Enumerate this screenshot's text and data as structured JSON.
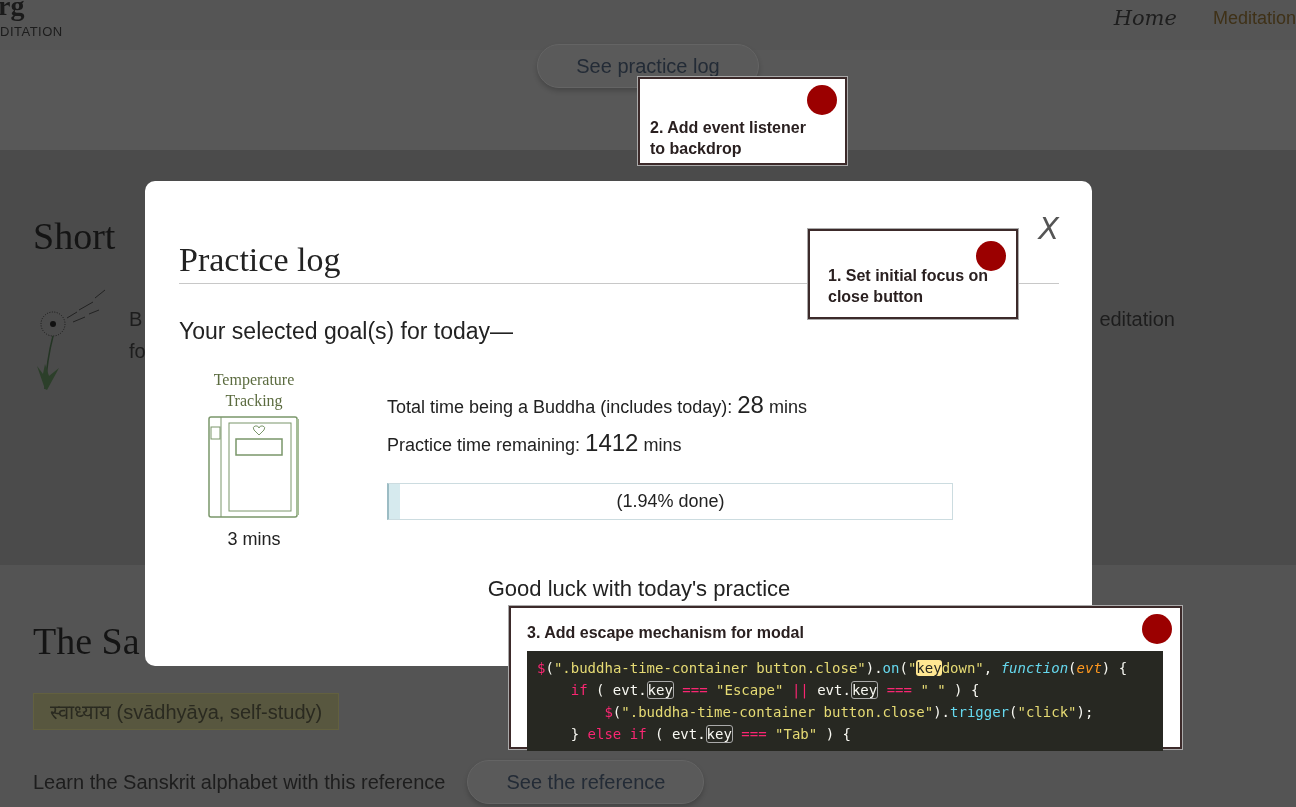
{
  "header": {
    "logo": "rg",
    "tagline": "DITATION",
    "nav": [
      {
        "label": "Home",
        "kind": "script"
      },
      {
        "label": "Meditation",
        "kind": "plain"
      }
    ]
  },
  "practice_section": {
    "button": "See practice log"
  },
  "short_section": {
    "heading": "Short",
    "text_lines": [
      "B",
      "fo"
    ],
    "text_right": "editation"
  },
  "sanskrit_section": {
    "heading": "The Sa",
    "tag": "स्वाध्याय (svādhyāya, self-study)",
    "text": "Learn the Sanskrit alphabet with this reference",
    "button": "See the reference"
  },
  "modal": {
    "title": "Practice log",
    "close": "X",
    "subtitle": "Your selected goal(s) for today—",
    "goal": {
      "name": "Temperature Tracking",
      "duration": "3 mins"
    },
    "stats": [
      {
        "label": "Total time being a Buddha (includes today): ",
        "value": "28",
        "unit": " mins"
      },
      {
        "label": "Practice time remaining: ",
        "value": "1412",
        "unit": " mins"
      }
    ],
    "progress": {
      "level": 0.0194,
      "label": "(1.94% done)"
    },
    "footer": "Good luck with today's practice"
  },
  "annotations": [
    {
      "kind": "text",
      "text": "2. Add event listener to backdrop"
    },
    {
      "kind": "text",
      "text": "1. Set initial focus on close button"
    },
    {
      "kind": "code",
      "text": "3. Add escape mechanism for modal",
      "code_lines": [
        [
          {
            "t": "$",
            "kind": "keyword"
          },
          {
            "t": "(",
            "kind": "plain"
          },
          {
            "t": "\".buddha-time-container button.close\"",
            "kind": "string"
          },
          {
            "t": ").",
            "kind": "plain"
          },
          {
            "t": "on",
            "kind": "method"
          },
          {
            "t": "(",
            "kind": "plain"
          },
          {
            "t": "\"",
            "kind": "string"
          },
          {
            "t": "key",
            "kind": "match"
          },
          {
            "t": "down\"",
            "kind": "string"
          },
          {
            "t": ", ",
            "kind": "plain"
          },
          {
            "t": "function",
            "kind": "storage"
          },
          {
            "t": "(",
            "kind": "plain"
          },
          {
            "t": "evt",
            "kind": "param"
          },
          {
            "t": ") {",
            "kind": "plain"
          }
        ],
        [
          {
            "t": "    if",
            "kind": "keyword"
          },
          {
            "t": " ( evt.",
            "kind": "plain"
          },
          {
            "t": "key",
            "kind": "boxed"
          },
          {
            "t": " ===",
            "kind": "keyword"
          },
          {
            "t": " \"Escape\" ",
            "kind": "string"
          },
          {
            "t": "||",
            "kind": "keyword"
          },
          {
            "t": " evt.",
            "kind": "plain"
          },
          {
            "t": "key",
            "kind": "boxed"
          },
          {
            "t": " === ",
            "kind": "keyword"
          },
          {
            "t": "\" \"",
            "kind": "string"
          },
          {
            "t": " ) {",
            "kind": "plain"
          }
        ],
        [
          {
            "t": "        $",
            "kind": "keyword"
          },
          {
            "t": "(",
            "kind": "plain"
          },
          {
            "t": "\".buddha-time-container button.close\"",
            "kind": "string"
          },
          {
            "t": ").",
            "kind": "plain"
          },
          {
            "t": "trigger",
            "kind": "method"
          },
          {
            "t": "(",
            "kind": "plain"
          },
          {
            "t": "\"click\"",
            "kind": "string"
          },
          {
            "t": ");",
            "kind": "plain"
          }
        ],
        [
          {
            "t": "    } ",
            "kind": "plain"
          },
          {
            "t": "else if",
            "kind": "keyword"
          },
          {
            "t": " ( evt.",
            "kind": "plain"
          },
          {
            "t": "key",
            "kind": "boxed"
          },
          {
            "t": " ===",
            "kind": "keyword"
          },
          {
            "t": " \"Tab\"",
            "kind": "string"
          },
          {
            "t": " ) {",
            "kind": "plain"
          }
        ]
      ]
    }
  ]
}
